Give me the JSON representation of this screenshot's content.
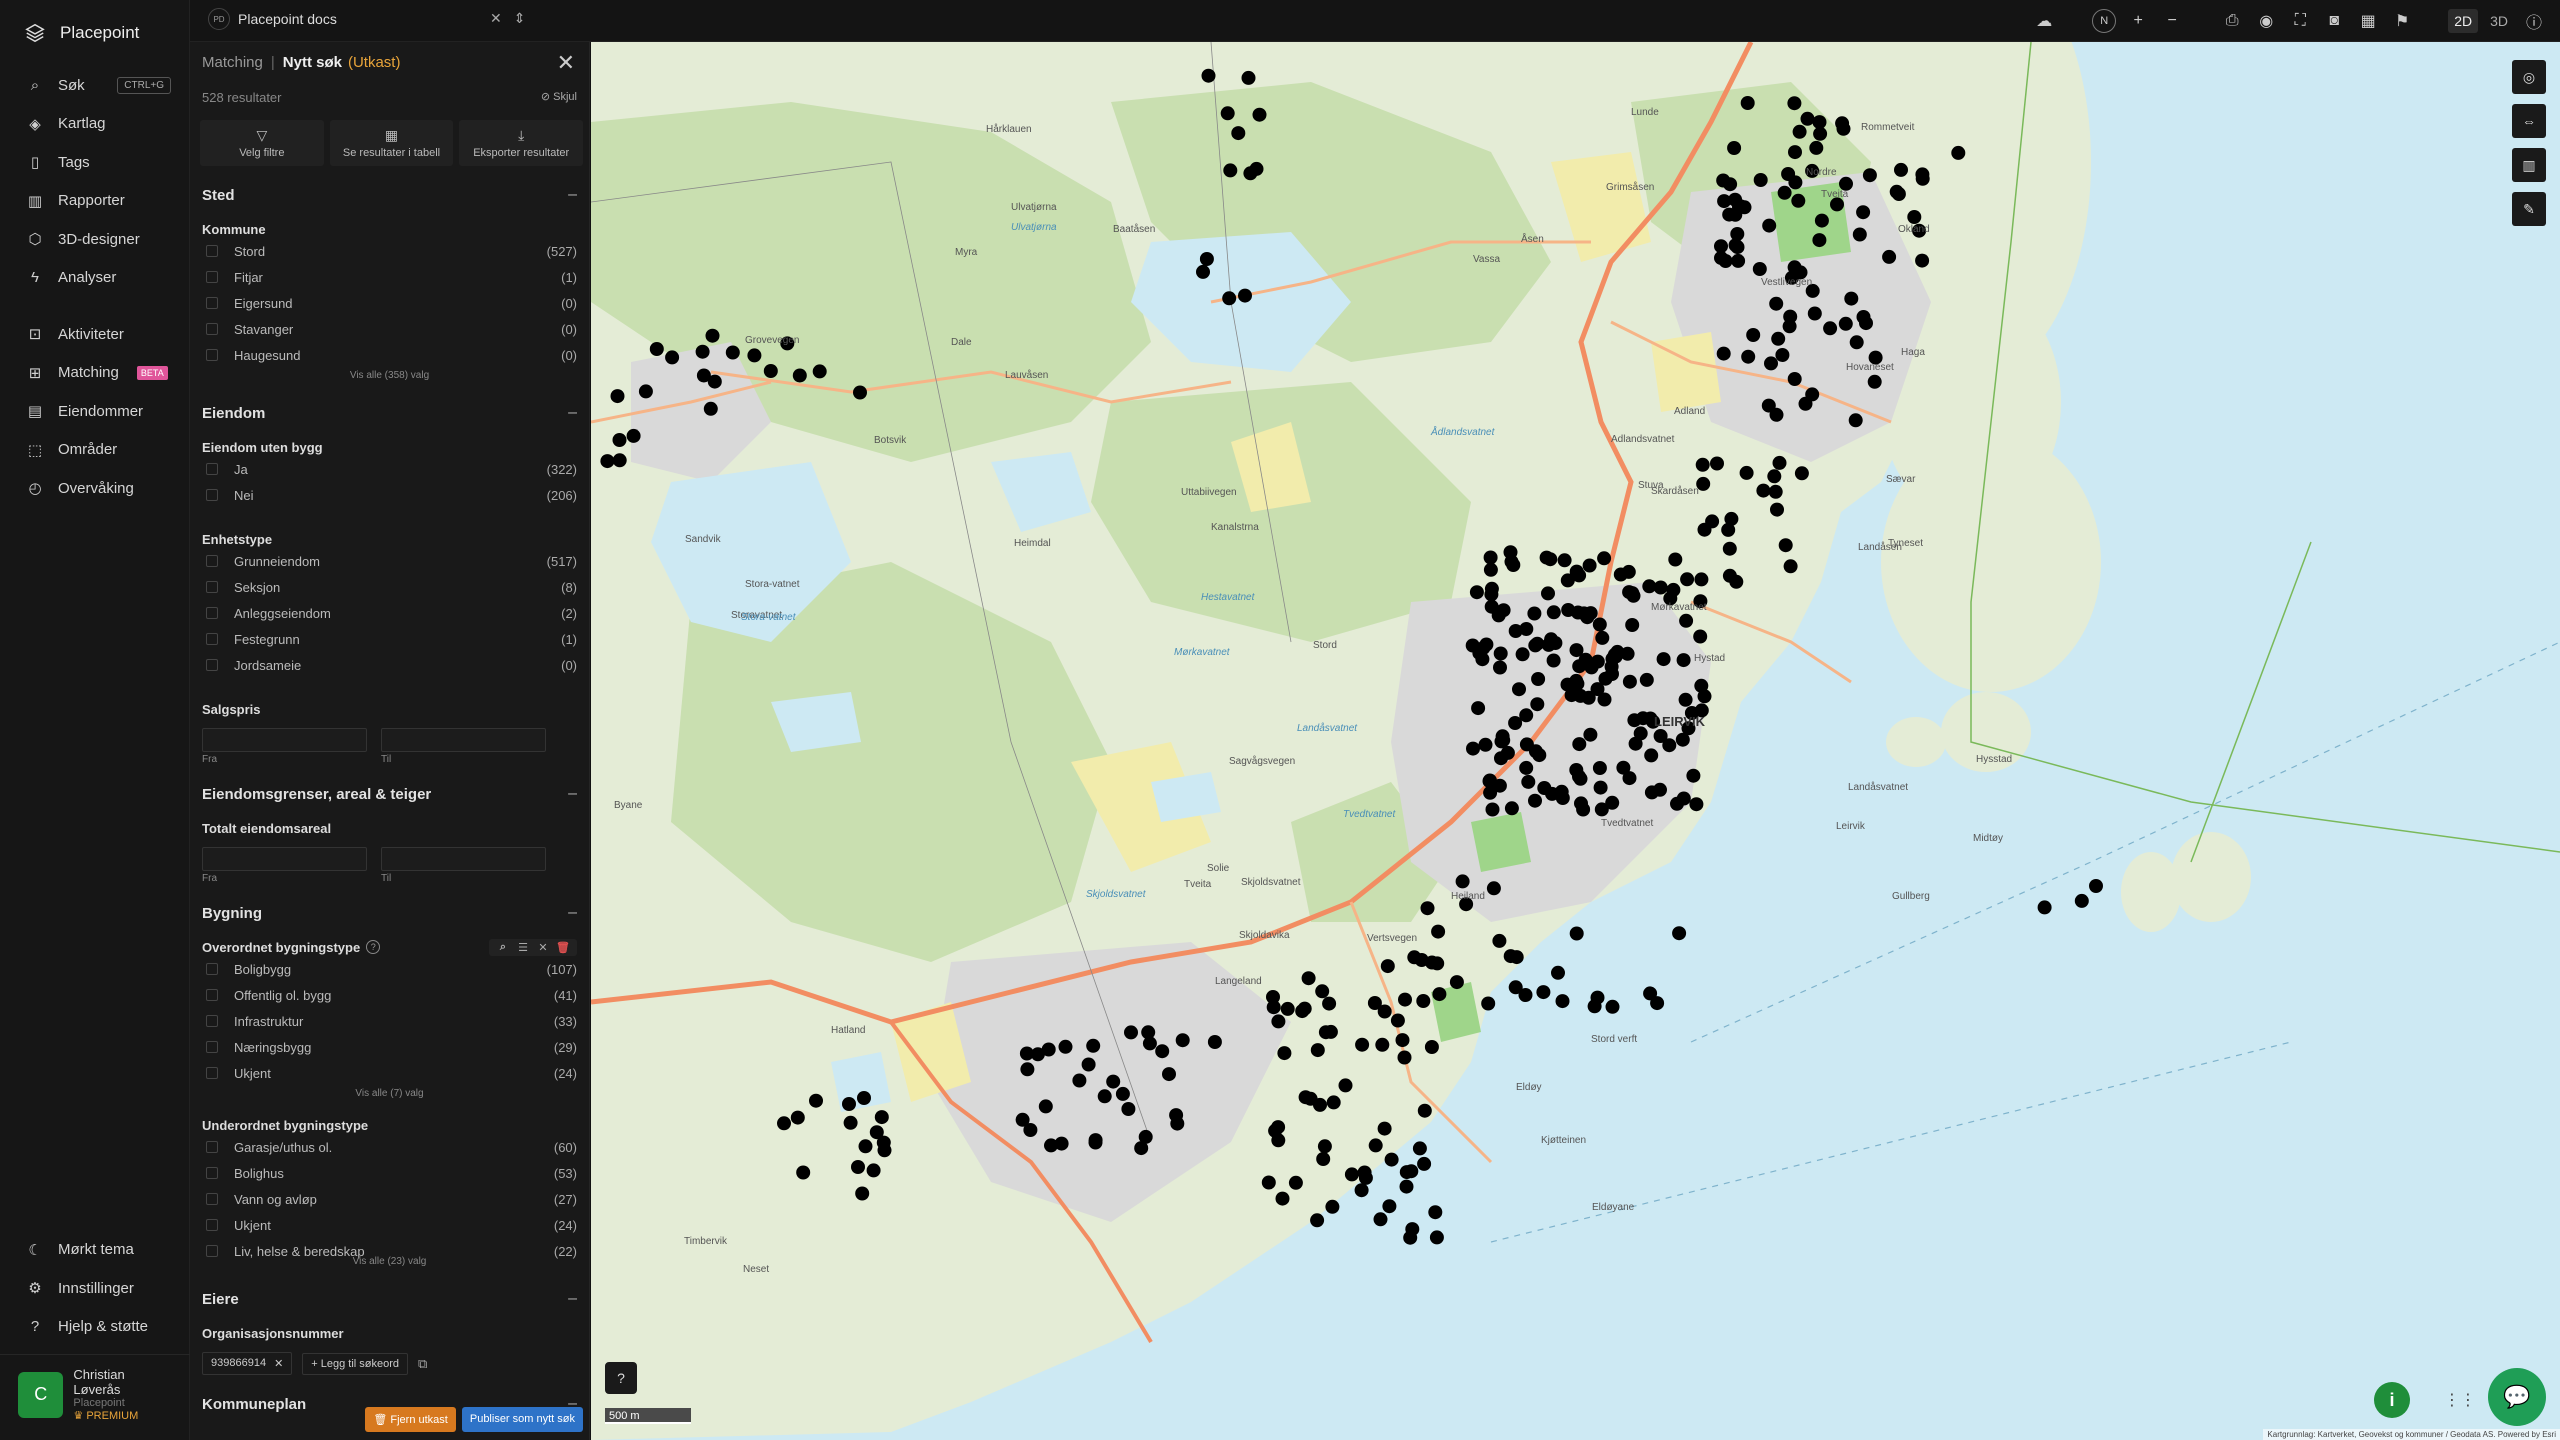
{
  "nav": {
    "brand": "Placepoint",
    "items": [
      {
        "label": "Søk",
        "icon": "search-icon",
        "kbd": "CTRL+G"
      },
      {
        "label": "Kartlag",
        "icon": "layers-icon"
      },
      {
        "label": "Tags",
        "icon": "bookmark-icon"
      },
      {
        "label": "Rapporter",
        "icon": "chart-icon"
      },
      {
        "label": "3D-designer",
        "icon": "cube-icon"
      },
      {
        "label": "Analyser",
        "icon": "bolt-icon"
      }
    ],
    "items2": [
      {
        "label": "Aktiviteter",
        "icon": "activity-icon"
      },
      {
        "label": "Matching",
        "icon": "matching-icon",
        "badge": "BETA"
      },
      {
        "label": "Eiendommer",
        "icon": "document-icon"
      },
      {
        "label": "Områder",
        "icon": "area-icon"
      },
      {
        "label": "Overvåking",
        "icon": "monitor-icon"
      }
    ],
    "bottom": [
      {
        "label": "Mørkt tema",
        "icon": "moon-icon"
      },
      {
        "label": "Innstillinger",
        "icon": "gear-icon"
      },
      {
        "label": "Hjelp & støtte",
        "icon": "help-icon"
      }
    ],
    "user": {
      "initial": "C",
      "name": "Christian Løverås",
      "org": "Placepoint",
      "plan": "PREMIUM"
    }
  },
  "topbar": {
    "project_badge": "PD",
    "project_name": "Placepoint docs",
    "compass": "N",
    "dim2d": "2D",
    "dim3d": "3D"
  },
  "panel": {
    "crumb": "Matching",
    "title": "Nytt søk",
    "draft": "(Utkast)",
    "results": "528 resultater",
    "hide": "Skjul",
    "actions": [
      {
        "label": "Velg filtre",
        "icon": "filter-icon"
      },
      {
        "label": "Se resultater i tabell",
        "icon": "table-icon"
      },
      {
        "label": "Eksporter resultater",
        "icon": "download-icon"
      }
    ],
    "sted": {
      "title": "Sted",
      "kommune_label": "Kommune",
      "kommune": [
        {
          "label": "Stord",
          "count": "(527)"
        },
        {
          "label": "Fitjar",
          "count": "(1)"
        },
        {
          "label": "Eigersund",
          "count": "(0)"
        },
        {
          "label": "Stavanger",
          "count": "(0)"
        },
        {
          "label": "Haugesund",
          "count": "(0)"
        }
      ],
      "more": "Vis alle (358) valg"
    },
    "eiendom": {
      "title": "Eiendom",
      "uten_label": "Eiendom uten bygg",
      "uten": [
        {
          "label": "Ja",
          "count": "(322)"
        },
        {
          "label": "Nei",
          "count": "(206)"
        }
      ],
      "enhet_label": "Enhetstype",
      "enhet": [
        {
          "label": "Grunneiendom",
          "count": "(517)"
        },
        {
          "label": "Seksjon",
          "count": "(8)"
        },
        {
          "label": "Anleggseiendom",
          "count": "(2)"
        },
        {
          "label": "Festegrunn",
          "count": "(1)"
        },
        {
          "label": "Jordsameie",
          "count": "(0)"
        }
      ],
      "pris_label": "Salgspris",
      "fra": "Fra",
      "til": "Til"
    },
    "grenser": {
      "title": "Eiendomsgrenser, areal & teiger",
      "areal_label": "Totalt eiendomsareal",
      "fra": "Fra",
      "til": "Til"
    },
    "bygning": {
      "title": "Bygning",
      "over_label": "Overordnet bygningstype",
      "over": [
        {
          "label": "Boligbygg",
          "count": "(107)"
        },
        {
          "label": "Offentlig ol. bygg",
          "count": "(41)"
        },
        {
          "label": "Infrastruktur",
          "count": "(33)"
        },
        {
          "label": "Næringsbygg",
          "count": "(29)"
        },
        {
          "label": "Ukjent",
          "count": "(24)"
        }
      ],
      "over_more": "Vis alle (7) valg",
      "under_label": "Underordnet bygningstype",
      "under": [
        {
          "label": "Garasje/uthus ol.",
          "count": "(60)"
        },
        {
          "label": "Bolighus",
          "count": "(53)"
        },
        {
          "label": "Vann og avløp",
          "count": "(27)"
        },
        {
          "label": "Ukjent",
          "count": "(24)"
        },
        {
          "label": "Liv, helse & beredskap",
          "count": "(22)"
        }
      ],
      "under_more": "Vis alle (23) valg"
    },
    "eiere": {
      "title": "Eiere",
      "org_label": "Organisasjonsnummer",
      "chip": "939866914",
      "add": "Legg til søkeord"
    },
    "kommuneplan": {
      "title": "Kommuneplan"
    },
    "remove_draft": "Fjern utkast",
    "publish": "Publiser som nytt søk"
  },
  "map": {
    "labels": {
      "town": "LEIRVIK",
      "places": [
        "Lunde",
        "Rommetveit",
        "Hårklauen",
        "Nordre",
        "Tveita",
        "Okland",
        "Grimsåsen",
        "Ulvatjørna",
        "Baatåsen",
        "Myra",
        "Vassa",
        "Åsen",
        "Hovaneset",
        "Vestlivegen",
        "Sævar",
        "Haga",
        "Tyneset",
        "Grovevegen",
        "Dale",
        "Lauvåsen",
        "Botsvik",
        "Adland",
        "Adlandsvatnet",
        "Stuva",
        "Sandvik",
        "Heimdal",
        "Uttabiivegen",
        "Stora-vatnet",
        "Skardåsen",
        "Kanalstrna",
        "Landåsen",
        "Hystad",
        "Stord",
        "Mørkavatnet",
        "Landåsvatnet",
        "Hysstad",
        "Midtøy",
        "Leirvik",
        "Byane",
        "Sagvågsvegen",
        "Tvedtvatnet",
        "Solie",
        "Tveita",
        "Skjoldsvatnet",
        "Gullberg",
        "Heiland",
        "Vertsvegen",
        "Stord verft",
        "Hatland",
        "Eldøy",
        "Kjøtteinen",
        "Eldøyane",
        "Timbervik",
        "Neset",
        "Skjoldavika",
        "Langeland",
        "Storavatnet"
      ],
      "water": [
        "Ulvatjørna",
        "Ådlandsvatnet",
        "Stora-vatnet",
        "Mørkavatnet",
        "Landåsvatnet",
        "Tvedtvatnet",
        "Skjoldsvatnet",
        "Hestavatnet"
      ]
    },
    "scale": "500 m",
    "attribution": "Kartgrunnlag: Kartverket, Geovekst og kommuner / Geodata AS. Powered by Esri"
  },
  "colors": {
    "accent": "#e8a43a",
    "brand_green": "#1f8e3a",
    "publish_blue": "#2e73c8",
    "beta_pink": "#e0559a"
  }
}
